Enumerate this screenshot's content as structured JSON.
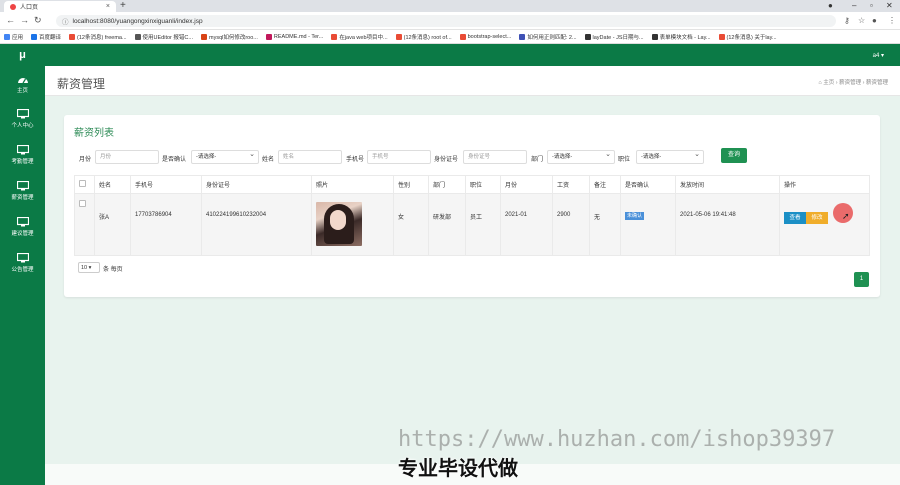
{
  "browser": {
    "tab_title": "人口页",
    "url": "localhost:8080/yuangongxinxiguanli/index.jsp",
    "bookmarks": [
      "应用",
      "百度翻译",
      "(12条消息) freema...",
      "使用UEditor 报错C...",
      "mysql如何修改roo...",
      "README.md - Ter...",
      "在java web项目中...",
      "(12条消息) root of...",
      "bootstrap-select...",
      "如何用正则匹配: 2...",
      "layDate - JS日期与...",
      "表单模块文档 - Lay...",
      "(12条消息) 关于lay..."
    ]
  },
  "app": {
    "logo": "μ",
    "user_menu": "a4 ▾"
  },
  "sidebar": {
    "items": [
      {
        "label": "主页",
        "icon": "dashboard-icon"
      },
      {
        "label": "个人中心",
        "icon": "monitor-icon"
      },
      {
        "label": "考勤管理",
        "icon": "monitor-icon"
      },
      {
        "label": "薪资管理",
        "icon": "monitor-icon"
      },
      {
        "label": "建议管理",
        "icon": "monitor-icon"
      },
      {
        "label": "公告管理",
        "icon": "monitor-icon"
      }
    ]
  },
  "page": {
    "title": "薪资管理",
    "breadcrumb": "⌂ 主页  ›  薪资管理  ›  薪资管理"
  },
  "panel": {
    "title": "薪资列表",
    "filters": {
      "month_label": "月份",
      "month_placeholder": "月份",
      "confirm_label": "是否确认",
      "confirm_value": "-请选择-",
      "name_label": "姓名",
      "name_placeholder": "姓名",
      "phone_label": "手机号",
      "phone_placeholder": "手机号",
      "idcard_label": "身份证号",
      "idcard_placeholder": "身份证号",
      "dept_label": "部门",
      "dept_value": "-请选择-",
      "position_label": "职位",
      "position_value": "-请选择-",
      "query_button": "查询"
    },
    "table": {
      "headers": [
        "姓名",
        "手机号",
        "身份证号",
        "照片",
        "性别",
        "部门",
        "职位",
        "月份",
        "工资",
        "备注",
        "是否确认",
        "发放时间",
        "操作"
      ],
      "row": {
        "name": "张A",
        "phone": "17703786904",
        "idcard": "410224199610232004",
        "gender": "女",
        "dept": "研发部",
        "position": "员工",
        "month": "2021-01",
        "salary": "2900",
        "remark": "无",
        "confirmed": "未确认",
        "paid_time": "2021-05-06 19:41:48",
        "view_button": "查看",
        "edit_button": "修改"
      }
    },
    "pagesize": "10 ▾",
    "pagesize_label": "条 每页",
    "current_page": "1"
  },
  "overlay": {
    "watermark": "https://www.huzhan.com/ishop39397",
    "caption": "专业毕设代做"
  },
  "colors": {
    "primary_green": "#0b7a46",
    "button_green": "#1f9152",
    "view_blue": "#1b8fc5",
    "edit_orange": "#f0ad2a"
  }
}
